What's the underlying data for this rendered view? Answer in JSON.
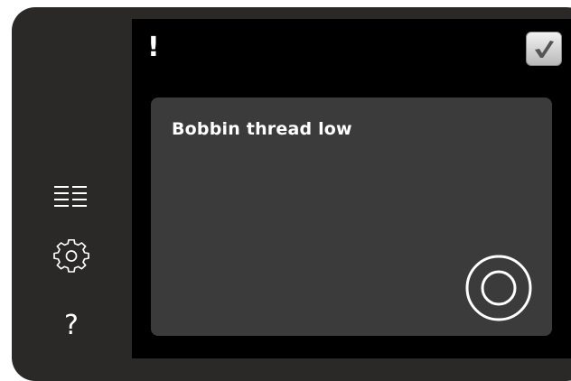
{
  "screen": {
    "alert_symbol": "!",
    "message": "Bobbin thread low"
  },
  "sidebar": {
    "items": [
      {
        "icon": "list-icon"
      },
      {
        "icon": "gear-icon"
      },
      {
        "icon": "help-icon",
        "label": "?"
      }
    ]
  },
  "colors": {
    "frame": "#2b2828",
    "screen_background": "#000000",
    "panel": "#3b3b3b",
    "text": "#ffffff",
    "check": "#555555"
  }
}
